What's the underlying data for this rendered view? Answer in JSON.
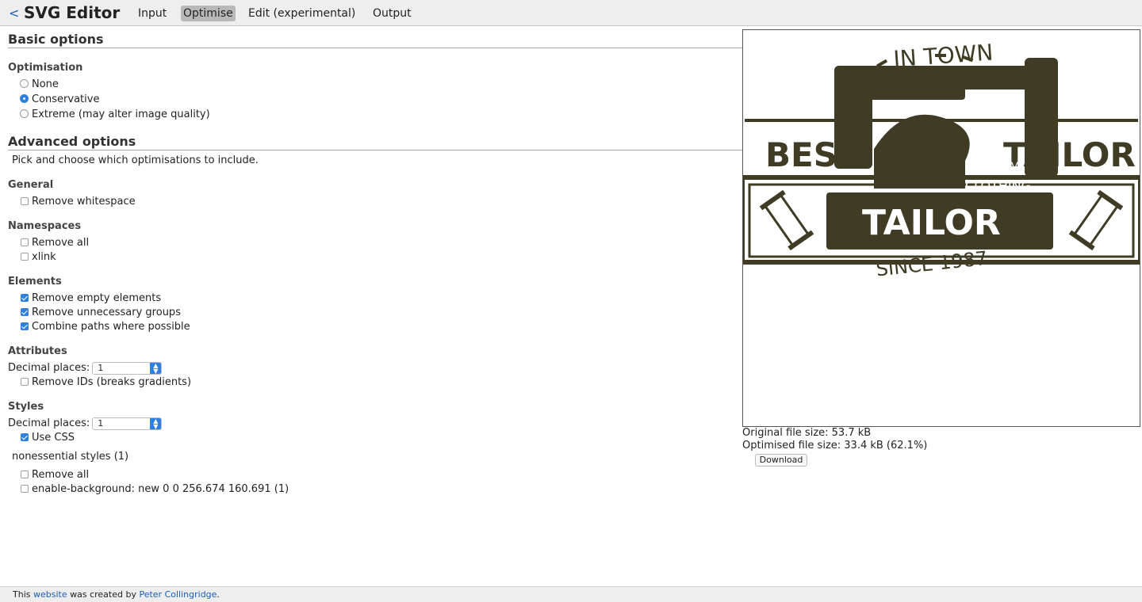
{
  "header": {
    "back_label": "<",
    "title": "SVG Editor",
    "tabs": [
      "Input",
      "Optimise",
      "Edit (experimental)",
      "Output"
    ],
    "active_tab": "Optimise"
  },
  "basic": {
    "heading": "Basic options",
    "optimisation_label": "Optimisation",
    "options": [
      {
        "label": "None",
        "selected": false
      },
      {
        "label": "Conservative",
        "selected": true
      },
      {
        "label": "Extreme (may alter image quality)",
        "selected": false
      }
    ]
  },
  "advanced": {
    "heading": "Advanced options",
    "description": "Pick and choose which optimisations to include.",
    "general": {
      "label": "General",
      "items": [
        {
          "label": "Remove whitespace",
          "checked": false
        }
      ]
    },
    "namespaces": {
      "label": "Namespaces",
      "items": [
        {
          "label": "Remove all",
          "checked": false
        },
        {
          "label": "xlink",
          "checked": false
        }
      ]
    },
    "elements": {
      "label": "Elements",
      "items": [
        {
          "label": "Remove empty elements",
          "checked": true
        },
        {
          "label": "Remove unnecessary groups",
          "checked": true
        },
        {
          "label": "Combine paths where possible",
          "checked": true
        }
      ]
    },
    "attributes": {
      "label": "Attributes",
      "decimal_label": "Decimal places:",
      "decimal_value": "1",
      "items": [
        {
          "label": "Remove IDs (breaks gradients)",
          "checked": false
        }
      ]
    },
    "styles": {
      "label": "Styles",
      "decimal_label": "Decimal places:",
      "decimal_value": "1",
      "items": [
        {
          "label": "Use CSS",
          "checked": true
        }
      ]
    },
    "nonessential": {
      "label": "nonessential styles (1)",
      "items": [
        {
          "label": "Remove all",
          "checked": false
        },
        {
          "label": "enable-background: new 0 0 256.674 160.691 (1)",
          "checked": false
        }
      ]
    }
  },
  "preview": {
    "logo_texts": {
      "arc_top": "IN TOWN",
      "left": "BEST",
      "right": "TAILOR",
      "center": "TAILOR",
      "custom1": "CUSTOM",
      "custom2": "CLOTHING",
      "since": "SINCE 1987"
    },
    "ink_color": "#3f3b24",
    "original_size": "Original file size: 53.7 kB",
    "optimised_size": "Optimised file size: 33.4 kB (62.1%)",
    "download_label": "Download"
  },
  "footer": {
    "prefix": "This ",
    "link1": "website",
    "middle": " was created by ",
    "link2": "Peter Collingridge",
    "suffix": "."
  }
}
